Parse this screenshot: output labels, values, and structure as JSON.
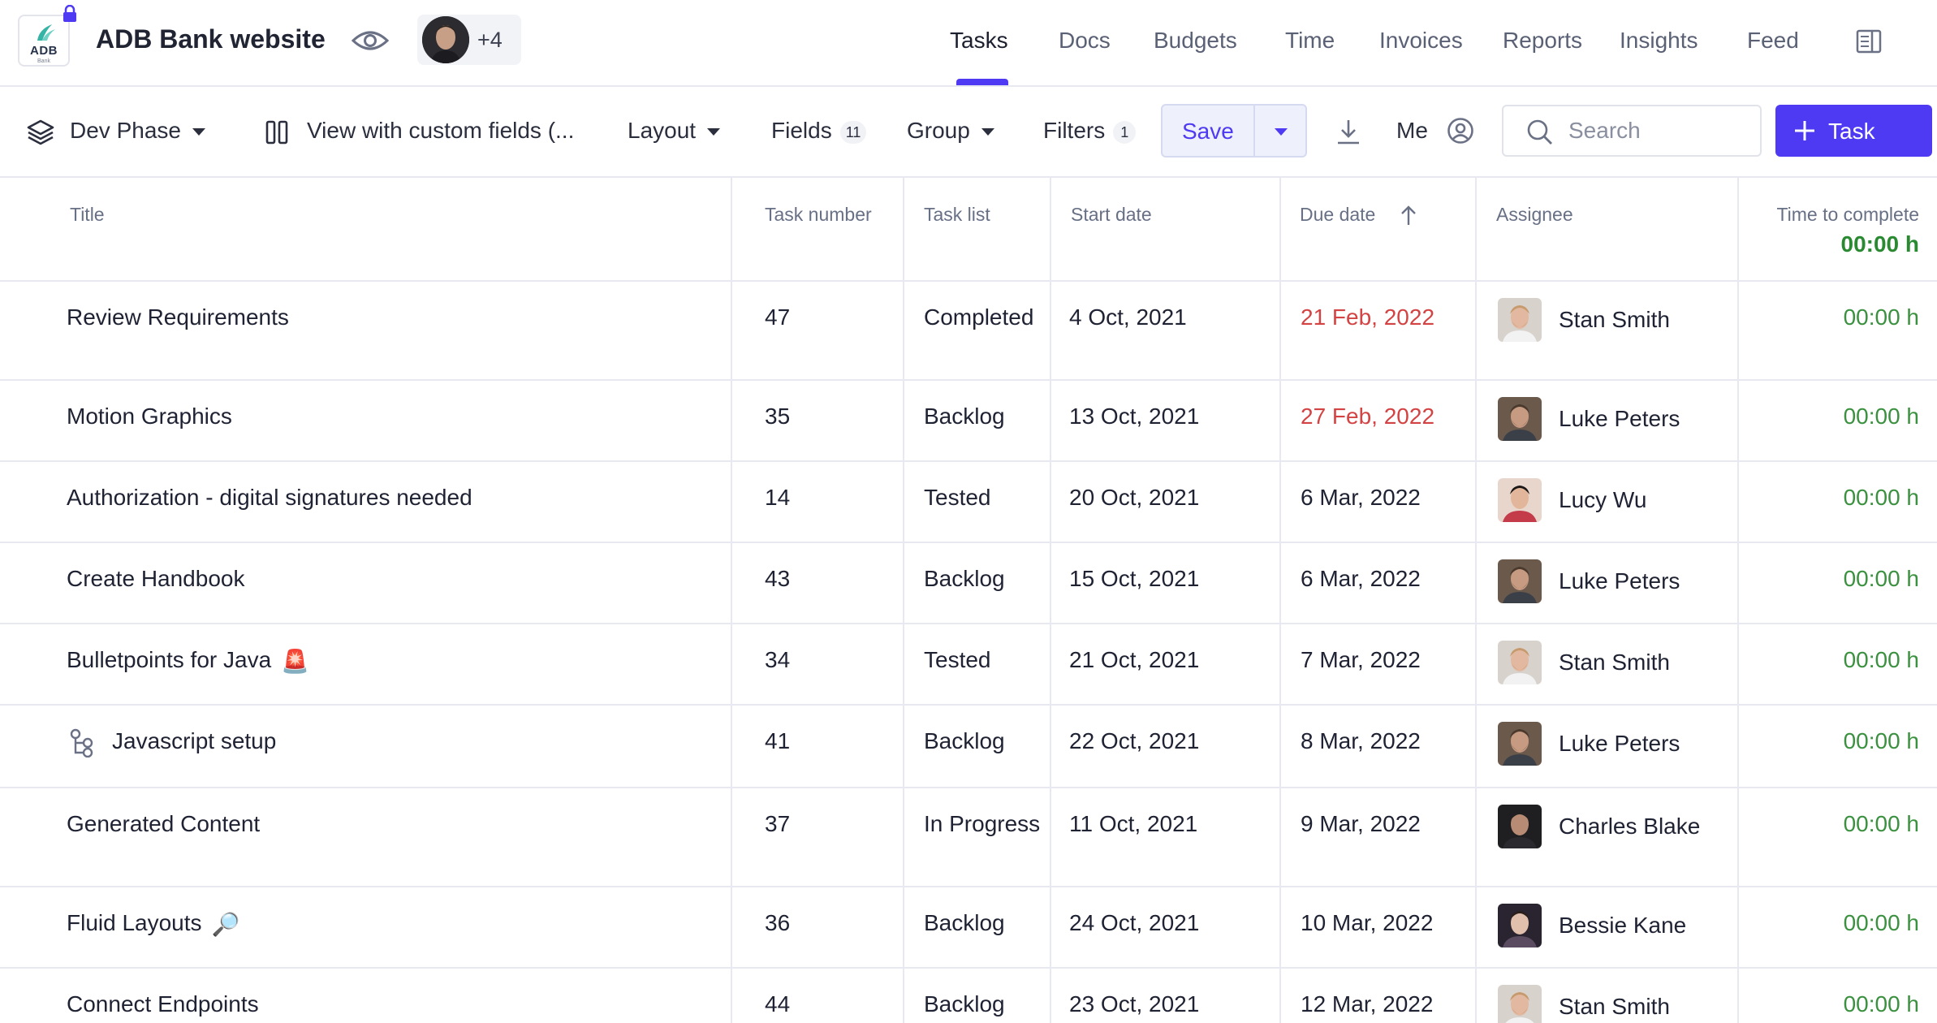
{
  "project": {
    "logo_text": "ADB",
    "logo_subtext": "Bank",
    "title": "ADB Bank website",
    "extra_members": "+4"
  },
  "nav": {
    "tabs": [
      {
        "label": "Tasks",
        "active": true
      },
      {
        "label": "Docs"
      },
      {
        "label": "Budgets"
      },
      {
        "label": "Time"
      },
      {
        "label": "Invoices"
      },
      {
        "label": "Reports"
      },
      {
        "label": "Insights"
      },
      {
        "label": "Feed"
      }
    ]
  },
  "toolbar": {
    "phase": "Dev Phase",
    "view": "View with custom fields (...",
    "layout": "Layout",
    "fields_label": "Fields",
    "fields_count": "11",
    "group": "Group",
    "filters_label": "Filters",
    "filters_count": "1",
    "save": "Save",
    "me": "Me",
    "search_placeholder": "Search",
    "add_task": "Task"
  },
  "table": {
    "columns": [
      "Title",
      "Task number",
      "Task list",
      "Start date",
      "Due date",
      "Assignee",
      "Time to complete"
    ],
    "time_total": "00:00 h",
    "rows": [
      {
        "title": "Review Requirements",
        "number": "47",
        "list": "Completed",
        "start": "4 Oct, 2021",
        "due": "21 Feb, 2022",
        "overdue": true,
        "assignee": "Stan Smith",
        "time": "00:00 h"
      },
      {
        "title": "Motion Graphics",
        "number": "35",
        "list": "Backlog",
        "start": "13 Oct, 2021",
        "due": "27 Feb, 2022",
        "overdue": true,
        "assignee": "Luke Peters",
        "time": "00:00 h"
      },
      {
        "title": "Authorization - digital signatures needed",
        "number": "14",
        "list": "Tested",
        "start": "20 Oct, 2021",
        "due": "6 Mar, 2022",
        "overdue": false,
        "assignee": "Lucy Wu",
        "time": "00:00 h"
      },
      {
        "title": "Create Handbook",
        "number": "43",
        "list": "Backlog",
        "start": "15 Oct, 2021",
        "due": "6 Mar, 2022",
        "overdue": false,
        "assignee": "Luke Peters",
        "time": "00:00 h"
      },
      {
        "title": "Bulletpoints for Java",
        "emoji": "🚨",
        "number": "34",
        "list": "Tested",
        "start": "21 Oct, 2021",
        "due": "7 Mar, 2022",
        "overdue": false,
        "assignee": "Stan Smith",
        "time": "00:00 h"
      },
      {
        "title": "Javascript setup",
        "subtask_icon": true,
        "number": "41",
        "list": "Backlog",
        "start": "22 Oct, 2021",
        "due": "8 Mar, 2022",
        "overdue": false,
        "assignee": "Luke Peters",
        "time": "00:00 h"
      },
      {
        "title": "Generated Content",
        "number": "37",
        "list": "In Progress",
        "start": "11 Oct, 2021",
        "due": "9 Mar, 2022",
        "overdue": false,
        "assignee": "Charles Blake",
        "time": "00:00 h"
      },
      {
        "title": "Fluid Layouts",
        "emoji": "🔎",
        "number": "36",
        "list": "Backlog",
        "start": "24 Oct, 2021",
        "due": "10 Mar, 2022",
        "overdue": false,
        "assignee": "Bessie Kane",
        "time": "00:00 h"
      },
      {
        "title": "Connect Endpoints",
        "number": "44",
        "list": "Backlog",
        "start": "23 Oct, 2021",
        "due": "12 Mar, 2022",
        "overdue": false,
        "assignee": "Stan Smith",
        "time": "00:00 h"
      }
    ]
  },
  "colors": {
    "accent": "#4d3af2",
    "overdue": "#d34343",
    "time": "#3b9140",
    "time_total": "#2a8a32",
    "border": "#e7e8f0"
  },
  "icons": [
    "lock-icon",
    "eye-icon",
    "layers-icon",
    "columns-icon",
    "sort-up-icon",
    "download-icon",
    "user-circle-icon",
    "search-icon",
    "plus-icon",
    "panel-icon",
    "subtask-icon"
  ]
}
